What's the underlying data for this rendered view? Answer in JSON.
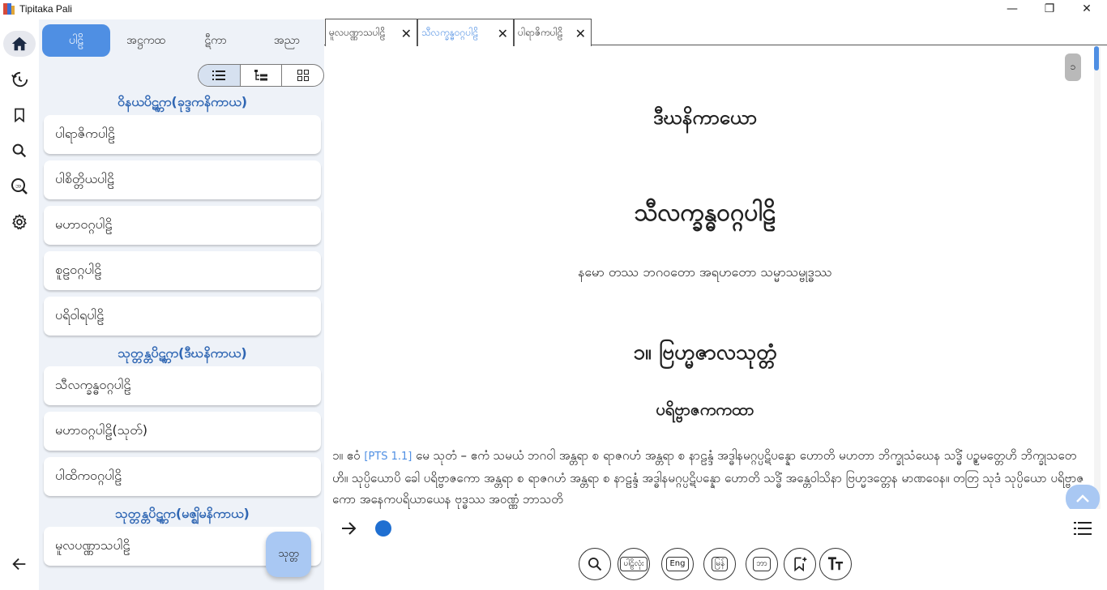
{
  "window": {
    "title": "Tipitaka Pali",
    "controls": {
      "minimize": "—",
      "restore": "❐",
      "close": "✕"
    }
  },
  "rail": {
    "items": [
      "home-icon",
      "history-icon",
      "bookmark-icon",
      "search-icon",
      "dictionary-icon",
      "settings-icon"
    ],
    "back_icon": "arrow-left-icon"
  },
  "sidebar": {
    "tabs": [
      {
        "label": "ပါဠိ",
        "active": true
      },
      {
        "label": "အဋ္ဌကထ",
        "active": false
      },
      {
        "label": "ဋီကာ",
        "active": false
      },
      {
        "label": "အညာ",
        "active": false
      }
    ],
    "view_modes": [
      "list-view-icon",
      "tree-view-icon",
      "grid-view-icon"
    ],
    "sections": [
      {
        "heading": "ဝိနယပိဋ္ကက(ခုဒ္ဒကနိကာယ)",
        "books": [
          "ပါရာဇိကပါဠိ",
          "ပါစိတ္တိယပါဠိ",
          "မဟာဝဂ္ဂပါဠိ",
          "စူဠဝဂ္ဂပါဠိ",
          "ပရိဝါရပါဠိ"
        ]
      },
      {
        "heading": "သုတ္တန္တပိဋ္ကက(ဒီဃနိကာယ)",
        "books": [
          "သီလက္ခန္ဓဝဂ္ဂပါဠိ",
          "မဟာဝဂ္ဂပါဠိ(သုတ်)",
          "ပါထိကဝဂ္ဂပါဠိ"
        ]
      },
      {
        "heading": "သုတ္တန္တပိဋ္ကက(မဇ္ဈိမနိကာယ)",
        "books": [
          "မူလပဏ္ဏာသပါဠိ"
        ]
      }
    ],
    "fab_label": "သုတ္တ"
  },
  "tabs": [
    {
      "label": "မူလပဏ္ဏာသပါဠိ",
      "active": false
    },
    {
      "label": "သီလက္ခန္ဓဝဂ္ဂပါဠိ",
      "active": true
    },
    {
      "label": "ပါရာဇိကပါဠိ",
      "active": false
    }
  ],
  "reader": {
    "page_number": "၁",
    "nikaya_heading": "ဒီဃနိကာယော",
    "book_heading": "သီလက္ခန္ဓဝဂ္ဂပါဠိ",
    "namo": "နမော တဿ ဘဂဝတော အရဟတော သမ္မာသမ္ဗုဒ္ဓဿ",
    "sutta_heading": "၁။ ဗြဟ္မဇာလသုတ္တံ",
    "sub_heading": "ပရိဗ္ဗာဇကကထာ",
    "para_number": "၁။ ဧဝံ",
    "pts_ref": "[PTS 1.1]",
    "para_text": "မေ သုတံ – ဧကံ သမယံ ဘဂဝါ အန္တရာ စ ရာဇဂဟံ အန္တရာ စ နာဠန္ဒံ အဒ္ဓါနမဂ္ဂပ္ပဋိပန္နော ဟောတိ မဟတာ ဘိက္ခုသံဃေန သဒ္ဓိံ ပဉ္စမတ္တေဟိ ဘိက္ခုသတေဟိ။ သုပ္ပိယောပိ ခေါ ပရိဗ္ဗာဇကော အန္တရာ စ ရာဇဂဟံ အန္တရာ စ နာဠန္ဒံ အဒ္ဓါနမဂ္ဂပ္ပဋိပန္နော ဟောတိ သဒ္ဓိံ အန္တေဝါသိနာ ဗြဟ္မဒတ္တေန မာဏဝေန။ တတြ သုဒံ သုပ္ပိယော ပရိဗ္ဗာဇကော အနေကပရိယာယေန ဗုဒ္ဓဿ အဝဏ္ဏံ ဘာသတိ"
  },
  "toolbar": {
    "tools": [
      {
        "name": "search-tool",
        "label": ""
      },
      {
        "name": "pali-words-tool",
        "label": "ပါဠိလုံး"
      },
      {
        "name": "english-tool",
        "label": "Eng"
      },
      {
        "name": "myanmar-tool",
        "label": "မြန်"
      },
      {
        "name": "script-tool",
        "label": "ဘာ"
      },
      {
        "name": "add-bookmark-tool",
        "label": ""
      },
      {
        "name": "font-size-tool",
        "label": ""
      }
    ],
    "accent": "#4f8fe3"
  }
}
